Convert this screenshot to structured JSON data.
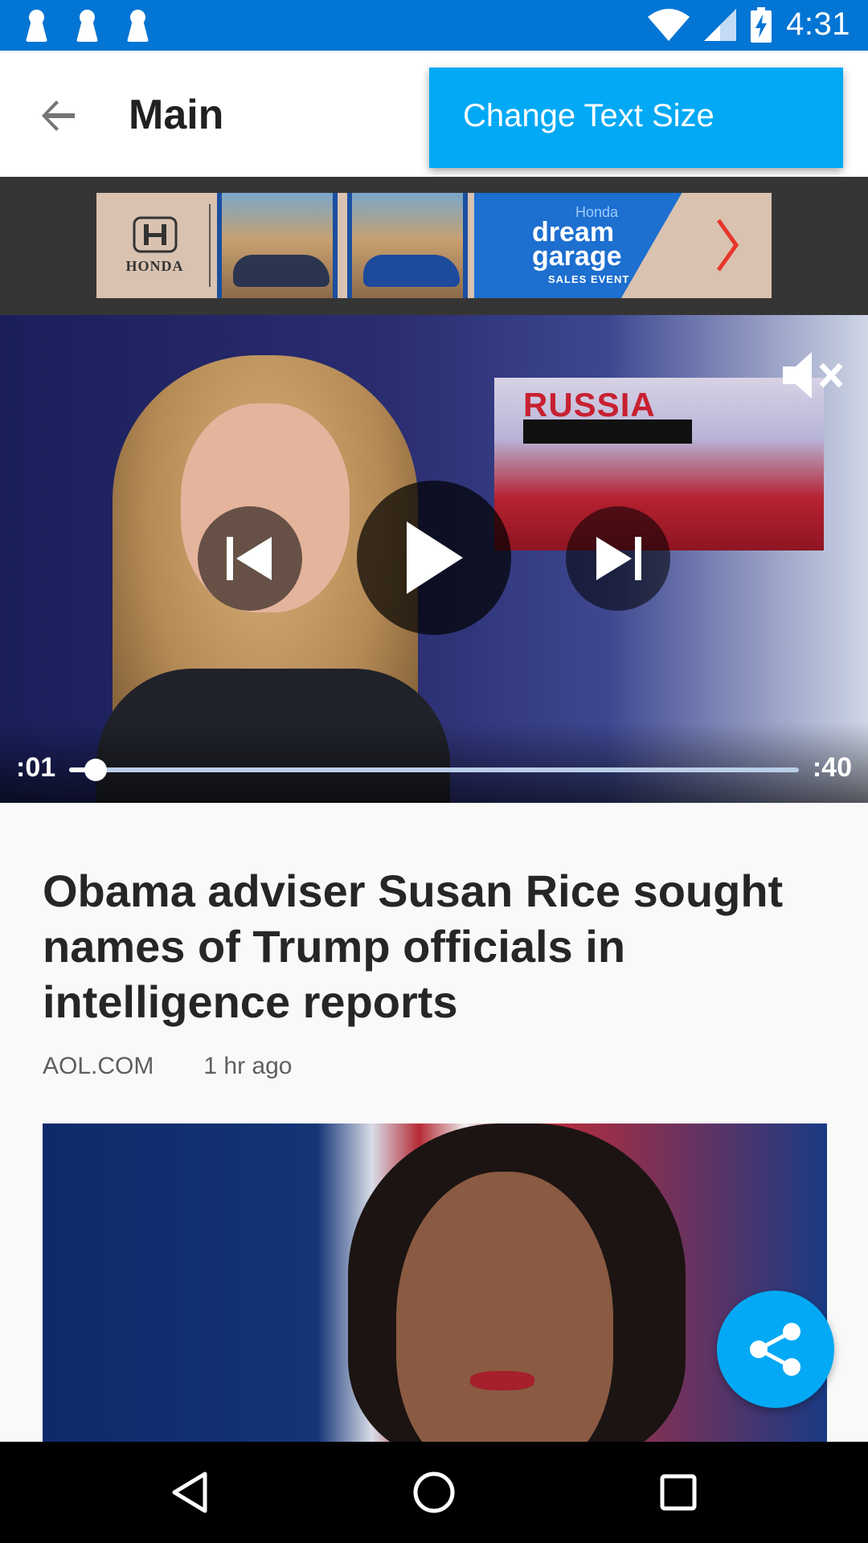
{
  "status_bar": {
    "time": "4:31",
    "notification_icons": [
      "person-icon",
      "person-icon",
      "person-icon"
    ],
    "system_icons": [
      "wifi-icon",
      "signal-icon",
      "battery-charging-icon"
    ],
    "background": "#0375d4"
  },
  "app_bar": {
    "title": "Main",
    "back_icon": "arrow-back-icon"
  },
  "popup_menu": {
    "items": [
      {
        "label": "Change Text Size"
      }
    ],
    "background": "#03a9f4"
  },
  "ad": {
    "brand": "HONDA",
    "tagline_small": "Honda",
    "tagline_line1": "dream",
    "tagline_line2": "garage",
    "tagline_event": "SALES EVENT",
    "arrow_icon": "chevron-right-icon"
  },
  "video": {
    "current_time": ":01",
    "duration": ":40",
    "progress_fraction": 0.036,
    "overlay_text": "RUSSIA",
    "controls": [
      "skip-previous-icon",
      "play-icon",
      "skip-next-icon"
    ],
    "mute_icon": "volume-off-icon"
  },
  "article": {
    "headline": "Obama adviser Susan Rice sought names of Trump officials in intelligence reports",
    "source": "AOL.COM",
    "time_ago": "1 hr ago"
  },
  "fab": {
    "icon": "share-icon",
    "color": "#03a9f4"
  },
  "nav_bar": {
    "buttons": [
      "back-triangle-icon",
      "home-circle-icon",
      "recents-square-icon"
    ]
  }
}
